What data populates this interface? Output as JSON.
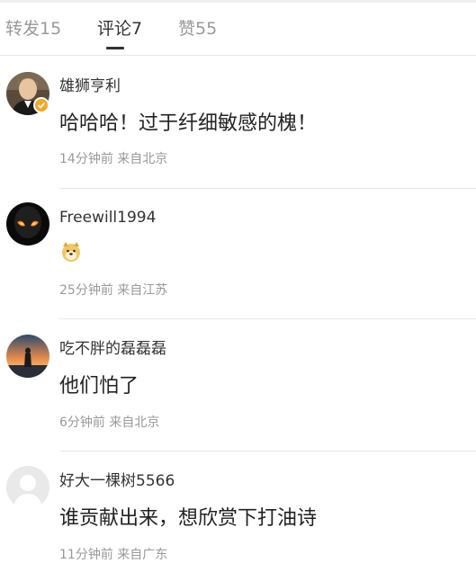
{
  "tabs": [
    {
      "label": "转发15"
    },
    {
      "label": "评论7"
    },
    {
      "label": "赞55"
    }
  ],
  "comments": [
    {
      "username": "雄狮亨利",
      "text": "哈哈哈！过于纤细敏感的槐！",
      "meta": "14分钟前 来自北京",
      "verified": true,
      "avatar": "portrait-avatar"
    },
    {
      "username": "Freewill1994",
      "text": "",
      "emoji": "doge-emoji",
      "meta": "25分钟前 来自江苏",
      "avatar": "alien-avatar"
    },
    {
      "username": "吃不胖的磊磊磊",
      "text": "他们怕了",
      "meta": "6分钟前 来自北京",
      "avatar": "sunset-avatar"
    },
    {
      "username": "好大一棵树5566",
      "text": "谁贡献出来，想欣赏下打油诗",
      "meta": "11分钟前 来自广东",
      "avatar": "default-avatar"
    }
  ],
  "colors": {
    "verified_badge": "#f5a623",
    "muted_text": "#999999"
  }
}
